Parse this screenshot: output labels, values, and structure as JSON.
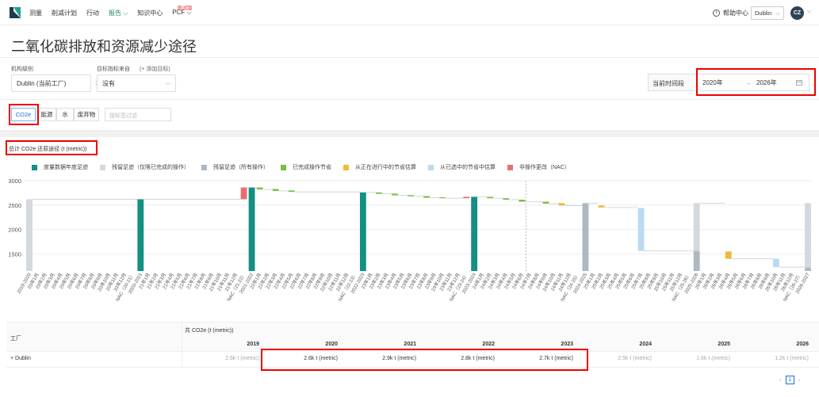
{
  "nav": {
    "items": [
      "测量",
      "削减计划",
      "行动",
      "报告 ⌵",
      "知识中心",
      "PCF ⌵"
    ],
    "beta_badge": "测试版",
    "help": "帮助中心",
    "site": "Dublin",
    "avatar": "CZ"
  },
  "page": {
    "title": "二氧化碳排放和资源减少途径"
  },
  "filters": {
    "org_level_label": "机构级别",
    "org_level_value": "Dublin (当前工厂)",
    "target_source_label": "目标指标来自",
    "add_target": "(+ 添加目标)",
    "target_value": "没有",
    "period_label": "当前时间段",
    "period_start": "2020年",
    "period_arrow": "→",
    "period_end": "2026年",
    "tabs": [
      "CO2e",
      "能源",
      "水",
      "废弃物"
    ],
    "tag_placeholder": "按标签过滤"
  },
  "chart_data": {
    "type": "bar",
    "title": "总计 CO2e 还原途径 (t (metric))",
    "legend": [
      {
        "name": "度量数据年度足迹",
        "color": "#138f84"
      },
      {
        "name": "残留足迹（仅限已完成的操作）",
        "color": "#d3d9de"
      },
      {
        "name": "残留足迹（所有操作）",
        "color": "#adb8c2"
      },
      {
        "name": "已完成操作节省",
        "color": "#7bbd44"
      },
      {
        "name": "从正在进行中的节省估算",
        "color": "#f0b93a"
      },
      {
        "name": "从已选中的节省中估算",
        "color": "#b9daf2"
      },
      {
        "name": "非操作更改（NAC）",
        "color": "#e86f6f"
      }
    ],
    "ylim": [
      1150,
      3000
    ],
    "yticks": [
      1500,
      2000,
      2500,
      3000
    ],
    "categories": [
      "2019-2020",
      "20年1月",
      "20年2月",
      "20年3月",
      "20年4月",
      "20年5月",
      "20年6月",
      "20年7月",
      "20年8月",
      "20年9月",
      "20年10月",
      "20年11月",
      "20年12月",
      "NAC（20-21）",
      "2020-2021",
      "21年1月",
      "21年2月",
      "21年3月",
      "21年4月",
      "21年5月",
      "21年6月",
      "21年7月",
      "21年8月",
      "21年9月",
      "21年10月",
      "21年11月",
      "21年12月",
      "NAC（21-22）",
      "2021-2022",
      "22年1月",
      "22年2月",
      "22年3月",
      "22年4月",
      "22年5月",
      "22年6月",
      "22年7月",
      "22年8月",
      "22年9月",
      "22年10月",
      "22年11月",
      "22年12月",
      "NAC（22-23）",
      "2022-2023",
      "23年1月",
      "23年2月",
      "23年3月",
      "23年4月",
      "23年5月",
      "23年6月",
      "23年7月",
      "23年8月",
      "23年9月",
      "23年10月",
      "23年11月",
      "23年12月",
      "NAC（23-24）",
      "2023-2024",
      "24年1月",
      "24年2月",
      "24年3月",
      "24年4月",
      "24年5月",
      "24年6月",
      "24年7月",
      "24年8月",
      "24年9月",
      "24年10月",
      "24年11月",
      "24年12月",
      "NAC（24-25）",
      "2024-2025",
      "25年1月",
      "25年2月",
      "25年3月",
      "25年4月",
      "25年5月",
      "25年6月",
      "25年7月",
      "25年8月",
      "25年9月",
      "25年10月",
      "25年11月",
      "25年12月",
      "NAC（25-26）",
      "2025-2026",
      "26年1月",
      "26年2月",
      "26年3月",
      "26年4月",
      "26年5月",
      "26年6月",
      "26年7月",
      "26年8月",
      "26年9月",
      "26年10月",
      "26年11月",
      "26年12月",
      "NAC（26-27）",
      "2026-2027"
    ],
    "bars": [
      {
        "i": 0,
        "low": 1150,
        "high": 2620,
        "kind": "residual_done"
      },
      {
        "i": 14,
        "low": 1150,
        "high": 2620,
        "kind": "measured"
      },
      {
        "i": 27,
        "low": 2620,
        "high": 2860,
        "kind": "nac"
      },
      {
        "i": 28,
        "low": 1150,
        "high": 2860,
        "kind": "measured"
      },
      {
        "i": 29,
        "low": 2820,
        "high": 2860,
        "kind": "done"
      },
      {
        "i": 31,
        "low": 2790,
        "high": 2830,
        "kind": "done"
      },
      {
        "i": 33,
        "low": 2770,
        "high": 2800,
        "kind": "done"
      },
      {
        "i": 42,
        "low": 1150,
        "high": 2760,
        "kind": "measured"
      },
      {
        "i": 44,
        "low": 2730,
        "high": 2760,
        "kind": "done"
      },
      {
        "i": 46,
        "low": 2700,
        "high": 2735,
        "kind": "done"
      },
      {
        "i": 48,
        "low": 2680,
        "high": 2705,
        "kind": "done"
      },
      {
        "i": 50,
        "low": 2650,
        "high": 2685,
        "kind": "done"
      },
      {
        "i": 52,
        "low": 2640,
        "high": 2660,
        "kind": "done"
      },
      {
        "i": 55,
        "low": 2640,
        "high": 2670,
        "kind": "nac"
      },
      {
        "i": 56,
        "low": 1150,
        "high": 2670,
        "kind": "measured"
      },
      {
        "i": 58,
        "low": 2640,
        "high": 2670,
        "kind": "done"
      },
      {
        "i": 60,
        "low": 2610,
        "high": 2640,
        "kind": "done"
      },
      {
        "i": 62,
        "low": 2570,
        "high": 2610,
        "kind": "done"
      },
      {
        "i": 65,
        "low": 2530,
        "high": 2570,
        "kind": "done"
      },
      {
        "i": 67,
        "low": 2490,
        "high": 2540,
        "kind": "ongoing"
      },
      {
        "i": 70,
        "low": 1150,
        "high": 2540,
        "kind": "residual_all"
      },
      {
        "i": 72,
        "low": 2450,
        "high": 2490,
        "kind": "ongoing"
      },
      {
        "i": 77,
        "low": 1560,
        "high": 2440,
        "kind": "selected"
      },
      {
        "i": 84,
        "low": 1150,
        "high": 1560,
        "kind": "residual_all"
      },
      {
        "i": 84,
        "low": 1560,
        "high": 2540,
        "kind": "residual_done"
      },
      {
        "i": 88,
        "low": 1400,
        "high": 1550,
        "kind": "ongoing"
      },
      {
        "i": 94,
        "low": 1230,
        "high": 1400,
        "kind": "selected"
      },
      {
        "i": 98,
        "low": 1150,
        "high": 1220,
        "kind": "residual_all"
      },
      {
        "i": 98,
        "low": 1220,
        "high": 2540,
        "kind": "residual_done"
      }
    ]
  },
  "table": {
    "col_factory": "工厂",
    "col_total": "共 CO2e (t (metric))",
    "years": [
      "2019",
      "2020",
      "2021",
      "2022",
      "2023",
      "2024",
      "2025",
      "2026"
    ],
    "rows": [
      {
        "name": "+ Dublin",
        "values": [
          "2.6k t (metric)",
          "2.6k t (metric)",
          "2.9k t (metric)",
          "2.8k t (metric)",
          "2.7k t (metric)",
          "2.5k t (metric)",
          "1.6k t (metric)",
          "1.2k t (metric)"
        ]
      }
    ]
  },
  "pagination": {
    "prev": "‹",
    "current": "1",
    "next": "›"
  }
}
